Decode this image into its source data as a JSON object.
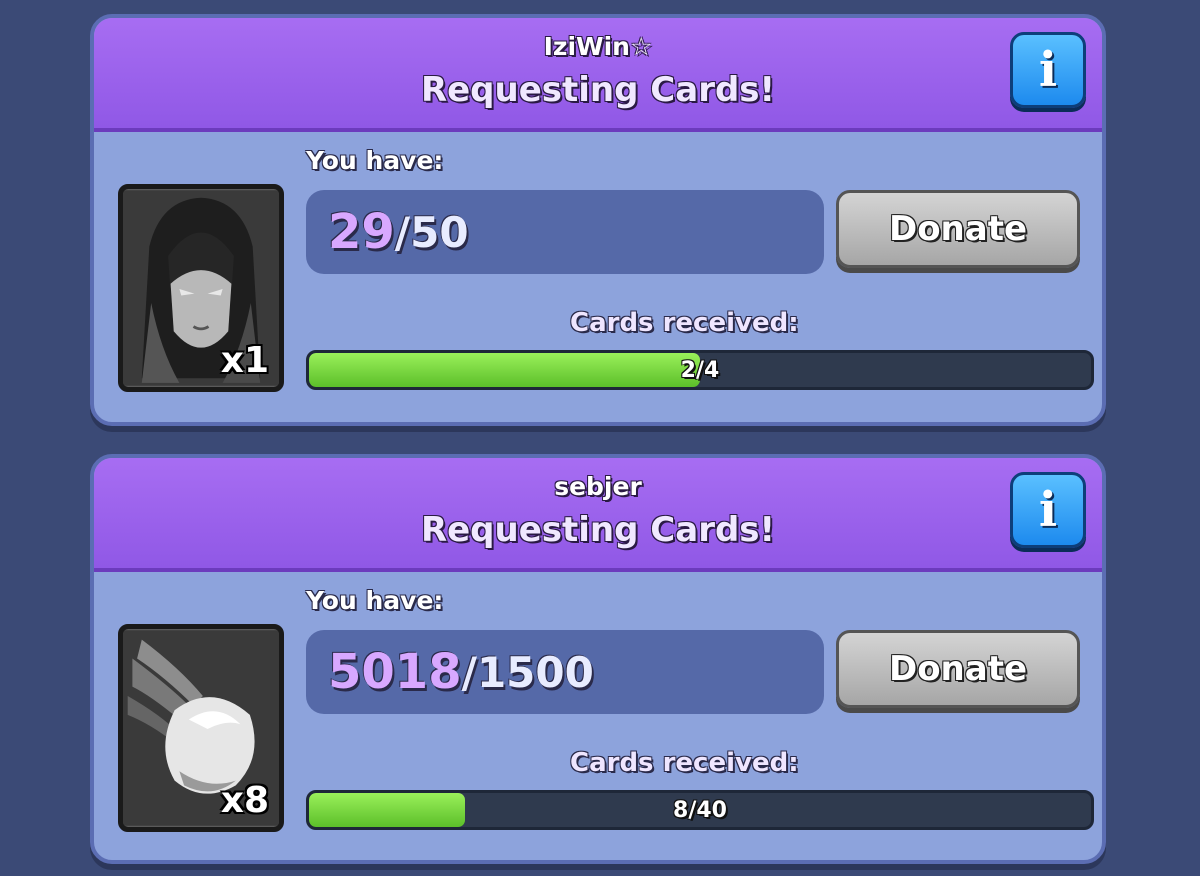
{
  "requests": [
    {
      "player_name": "IziWin☆",
      "title": "Requesting Cards!",
      "info_label": "i",
      "card": {
        "icon": "witch-card-icon",
        "count_label": "x1"
      },
      "you_have_label": "You have:",
      "have_current": "29",
      "have_separator": "/",
      "have_needed": "50",
      "donate_label": "Donate",
      "received_label": "Cards received:",
      "received_text": "2/4",
      "received_fraction": 0.5
    },
    {
      "player_name": "sebjer",
      "title": "Requesting Cards!",
      "info_label": "i",
      "card": {
        "icon": "snowball-card-icon",
        "count_label": "x8"
      },
      "you_have_label": "You have:",
      "have_current": "5018",
      "have_separator": "/",
      "have_needed": "1500",
      "donate_label": "Donate",
      "received_label": "Cards received:",
      "received_text": "8/40",
      "received_fraction": 0.2
    }
  ],
  "colors": {
    "background": "#3b4a76",
    "header_purple": "#9058e6",
    "panel_blue": "#8da3dc",
    "progress_green": "#5cbf2a",
    "info_blue": "#1d8aee",
    "donate_gray": "#a6a6a6"
  }
}
